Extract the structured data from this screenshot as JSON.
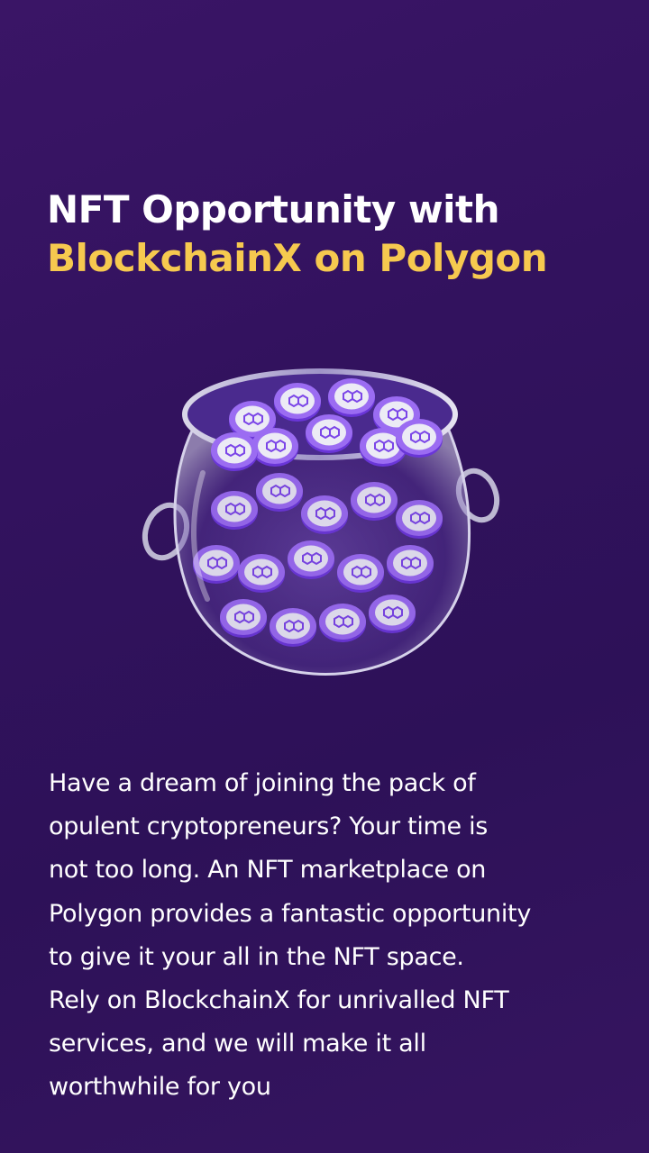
{
  "title": {
    "line1": "NFT Opportunity with",
    "line2": "BlockchainX on Polygon"
  },
  "illustration": {
    "icon": "polygon-coin-jar-icon",
    "coin_color": "#8b5cf6",
    "coin_face": "#e9e6f4"
  },
  "body": {
    "lines": [
      "Have a dream of joining the pack of",
      "opulent cryptopreneurs? Your time is",
      "not too long. An NFT marketplace on",
      "Polygon provides a fantastic opportunity",
      "to give it your all in the NFT space.",
      "Rely on BlockchainX for unrivalled NFT",
      "services, and we will make it all",
      "worthwhile for you"
    ]
  },
  "colors": {
    "background": "#32125e",
    "accent": "#f6c94f",
    "text": "#ffffff"
  }
}
